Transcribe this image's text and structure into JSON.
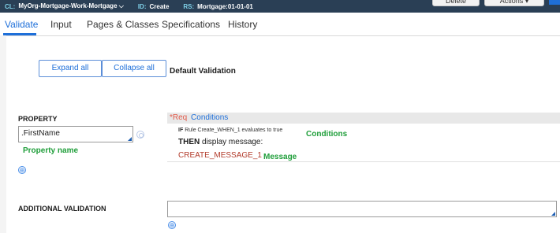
{
  "header": {
    "cl_label": "CL:",
    "cl_value": "MyOrg-Mortgage-Work-Mortgage ⌵",
    "id_label": "ID:",
    "id_value": "Create",
    "rs_label": "RS:",
    "rs_value": "Mortgage:01-01-01",
    "delete_label": "Delete",
    "actions_label": "Actions ▾"
  },
  "tabs": [
    {
      "label": "Validate",
      "active": true
    },
    {
      "label": "Input"
    },
    {
      "label": "Pages & Classes"
    },
    {
      "label": "Specifications"
    },
    {
      "label": "History"
    }
  ],
  "toolbar": {
    "expand_label": "Expand all",
    "collapse_label": "Collapse all",
    "default_validation": "Default Validation"
  },
  "property": {
    "heading": "PROPERTY",
    "value": ".FirstName",
    "annotation": "Property name"
  },
  "conditions": {
    "req": "*Req",
    "label": "Conditions",
    "if_keyword": "IF",
    "rule_text": "Rule Create_WHEN_1 evaluates to true",
    "then_keyword": "THEN",
    "then_text": "display message:",
    "message": "CREATE_MESSAGE_1",
    "annotation_conditions": "Conditions",
    "annotation_message": "Message"
  },
  "additional": {
    "heading": "ADDITIONAL VALIDATION",
    "value": ""
  },
  "icons": {
    "plus": "⊕"
  }
}
